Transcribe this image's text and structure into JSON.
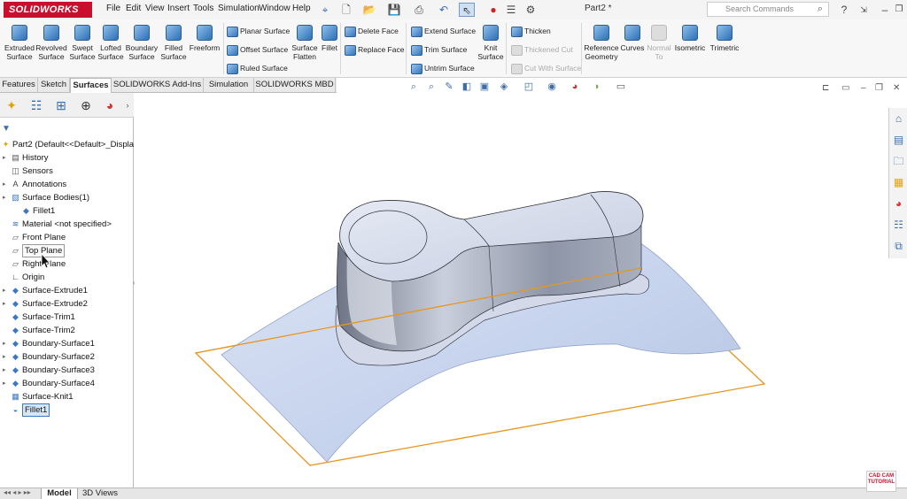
{
  "app": {
    "brand": "SOLIDWORKS",
    "doc_title": "Part2 *",
    "search_placeholder": "Search Commands"
  },
  "menu": [
    "File",
    "Edit",
    "View",
    "Insert",
    "Tools",
    "Simulation",
    "Window",
    "Help"
  ],
  "commands": {
    "big": [
      {
        "id": "extruded-surface",
        "label": "Extruded Surface"
      },
      {
        "id": "revolved-surface",
        "label": "Revolved Surface"
      },
      {
        "id": "swept-surface",
        "label": "Swept Surface"
      },
      {
        "id": "lofted-surface",
        "label": "Lofted Surface"
      },
      {
        "id": "boundary-surface",
        "label": "Boundary Surface"
      },
      {
        "id": "filled-surface",
        "label": "Filled Surface"
      },
      {
        "id": "freeform",
        "label": "Freeform"
      }
    ],
    "col1": [
      "Planar Surface",
      "Offset Surface",
      "Ruled Surface"
    ],
    "surface_flatten": "Surface Flatten",
    "fillet": "Fillet",
    "col2": [
      "Delete Face",
      "Replace Face"
    ],
    "col3": [
      "Extend Surface",
      "Trim Surface",
      "Untrim Surface"
    ],
    "knit_surface": "Knit Surface",
    "col4": [
      "Thicken",
      "Thickened Cut",
      "Cut With Surface"
    ],
    "reference_geometry": "Reference Geometry",
    "curves": "Curves",
    "normal_to": "Normal To",
    "isometric": "Isometric",
    "trimetric": "Trimetric"
  },
  "tabs": [
    "Features",
    "Sketch",
    "Surfaces",
    "SOLIDWORKS Add-Ins",
    "Simulation",
    "SOLIDWORKS MBD"
  ],
  "active_tab": "Surfaces",
  "tree": {
    "root": "Part2  (Default<<Default>_Displa",
    "items": [
      {
        "label": "History",
        "icon": "history-icon",
        "arrow": true
      },
      {
        "label": "Sensors",
        "icon": "sensors-icon",
        "arrow": false
      },
      {
        "label": "Annotations",
        "icon": "annotations-icon",
        "arrow": true
      },
      {
        "label": "Surface Bodies(1)",
        "icon": "surface-bodies-icon",
        "arrow": true
      },
      {
        "label": "Fillet1",
        "icon": "surface-icon",
        "arrow": false,
        "indent": true
      },
      {
        "label": "Material <not specified>",
        "icon": "material-icon",
        "arrow": false
      },
      {
        "label": "Front Plane",
        "icon": "plane-icon",
        "arrow": false
      },
      {
        "label": "Top Plane",
        "icon": "plane-icon",
        "arrow": false,
        "hover": true
      },
      {
        "label": "Right Plane",
        "icon": "plane-icon",
        "arrow": false
      },
      {
        "label": "Origin",
        "icon": "origin-icon",
        "arrow": false
      },
      {
        "label": "Surface-Extrude1",
        "icon": "surface-icon",
        "arrow": true
      },
      {
        "label": "Surface-Extrude2",
        "icon": "surface-icon",
        "arrow": true
      },
      {
        "label": "Surface-Trim1",
        "icon": "surface-icon",
        "arrow": false
      },
      {
        "label": "Surface-Trim2",
        "icon": "surface-icon",
        "arrow": false
      },
      {
        "label": "Boundary-Surface1",
        "icon": "surface-icon",
        "arrow": true
      },
      {
        "label": "Boundary-Surface2",
        "icon": "surface-icon",
        "arrow": true
      },
      {
        "label": "Boundary-Surface3",
        "icon": "surface-icon",
        "arrow": true
      },
      {
        "label": "Boundary-Surface4",
        "icon": "surface-icon",
        "arrow": true
      },
      {
        "label": "Surface-Knit1",
        "icon": "knit-icon",
        "arrow": false
      },
      {
        "label": "Fillet1",
        "icon": "fillet-icon",
        "arrow": false,
        "selected": true
      }
    ]
  },
  "bottom_tabs": [
    "Model",
    "3D Views"
  ],
  "watermark": "CAD CAM TUTORIAL",
  "colors": {
    "brand": "#c8102e",
    "selection": "#3b78c4",
    "plane_edge": "#e8961e",
    "surface": "#c5d3ec"
  }
}
